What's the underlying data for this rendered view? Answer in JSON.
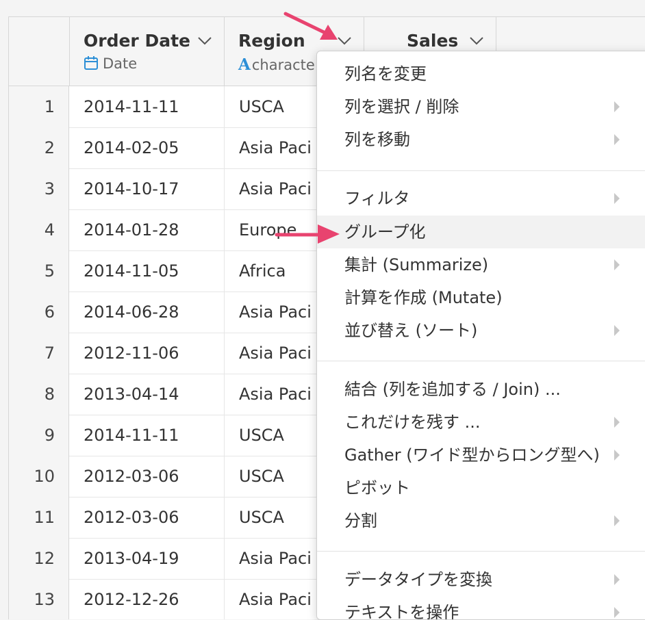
{
  "columns": [
    {
      "name": "Order Date",
      "type": "Date",
      "type_icon": "calendar-icon"
    },
    {
      "name": "Region",
      "type": "characte",
      "type_icon": "character-type-icon"
    },
    {
      "name": "Sales",
      "type": "",
      "type_icon": ""
    }
  ],
  "rows": [
    {
      "num": "1",
      "date": "2014-11-11",
      "region": "USCA"
    },
    {
      "num": "2",
      "date": "2014-02-05",
      "region": "Asia Paci"
    },
    {
      "num": "3",
      "date": "2014-10-17",
      "region": "Asia Paci"
    },
    {
      "num": "4",
      "date": "2014-01-28",
      "region": "Europe"
    },
    {
      "num": "5",
      "date": "2014-11-05",
      "region": "Africa"
    },
    {
      "num": "6",
      "date": "2014-06-28",
      "region": "Asia Paci"
    },
    {
      "num": "7",
      "date": "2012-11-06",
      "region": "Asia Paci"
    },
    {
      "num": "8",
      "date": "2013-04-14",
      "region": "Asia Paci"
    },
    {
      "num": "9",
      "date": "2014-11-11",
      "region": "USCA"
    },
    {
      "num": "10",
      "date": "2012-03-06",
      "region": "USCA"
    },
    {
      "num": "11",
      "date": "2012-03-06",
      "region": "USCA"
    },
    {
      "num": "12",
      "date": "2013-04-19",
      "region": "Asia Paci"
    },
    {
      "num": "13",
      "date": "2012-12-26",
      "region": "Asia Paci"
    }
  ],
  "menu": {
    "items": [
      {
        "label": "列名を変更",
        "submenu": false
      },
      {
        "label": "列を選択 / 削除",
        "submenu": true
      },
      {
        "label": "列を移動",
        "submenu": true
      },
      {
        "label": "フィルタ",
        "submenu": true
      },
      {
        "label": "グループ化",
        "submenu": false,
        "highlighted": true
      },
      {
        "label": "集計 (Summarize)",
        "submenu": true
      },
      {
        "label": "計算を作成 (Mutate)",
        "submenu": false
      },
      {
        "label": "並び替え (ソート)",
        "submenu": true
      },
      {
        "label": "結合 (列を追加する / Join) ...",
        "submenu": false
      },
      {
        "label": "これだけを残す ...",
        "submenu": true
      },
      {
        "label": "Gather (ワイド型からロング型へ)",
        "submenu": true
      },
      {
        "label": "ピボット",
        "submenu": false
      },
      {
        "label": "分割",
        "submenu": true
      },
      {
        "label": "データタイプを変換",
        "submenu": true
      },
      {
        "label": "テキストを操作",
        "submenu": true
      }
    ]
  },
  "colors": {
    "annotation_arrow": "#e8436f",
    "type_icon_blue": "#2d8fd6"
  }
}
